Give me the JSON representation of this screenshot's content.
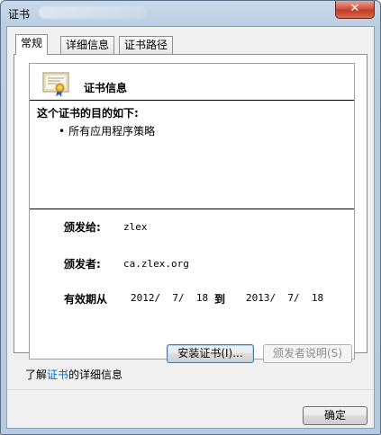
{
  "window": {
    "title": "证书",
    "close_glyph": "✕"
  },
  "tabs": [
    {
      "label": "常规"
    },
    {
      "label": "详细信息"
    },
    {
      "label": "证书路径"
    }
  ],
  "certificate": {
    "icon": "certificate-icon",
    "heading": "证书信息",
    "purpose_heading": "这个证书的目的如下:",
    "purposes": [
      "所有应用程序策略"
    ],
    "issued_to_label": "颁发给:",
    "issued_to_value": "zlex",
    "issued_by_label": "颁发者:",
    "issued_by_value": "ca.zlex.org",
    "valid_from_label": "有效期从",
    "valid_from_value": "2012/  7/  18",
    "valid_to_label": "到",
    "valid_to_value": "2013/  7/  18"
  },
  "buttons": {
    "install": "安装证书(I)...",
    "issuer_statement": "颁发者说明(S)",
    "ok": "确定"
  },
  "learn_more": {
    "prefix": "了解",
    "link": "证书",
    "suffix": "的详细信息"
  }
}
